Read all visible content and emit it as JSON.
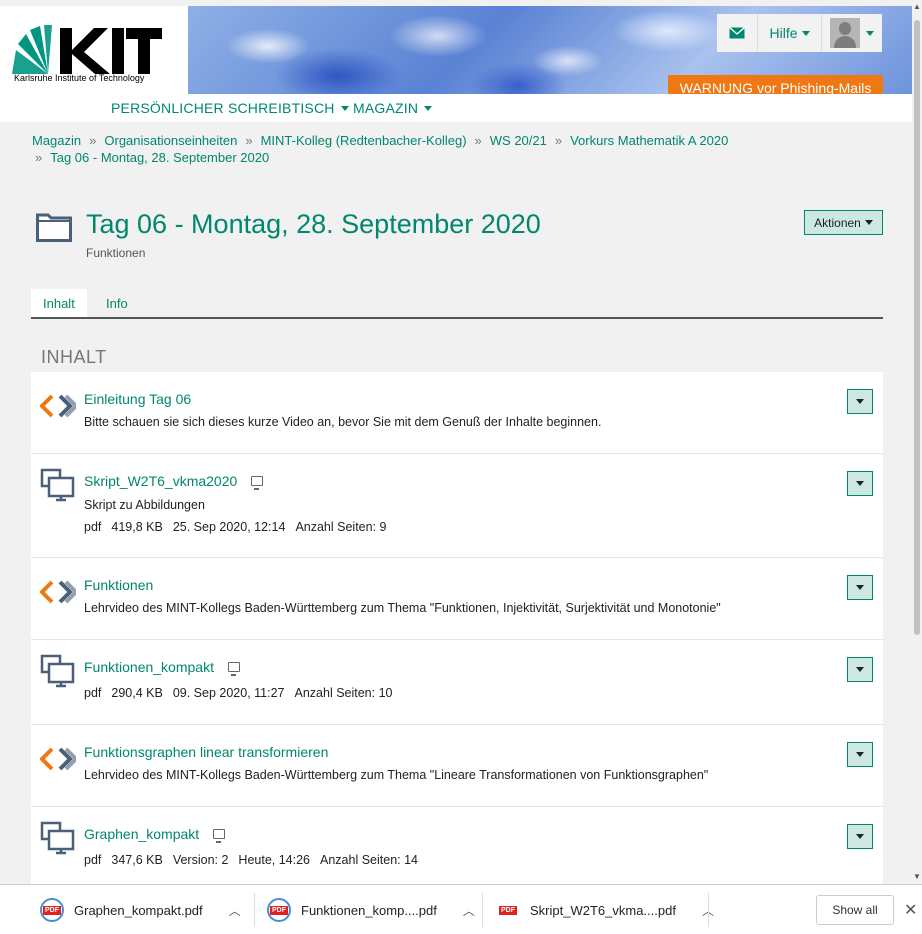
{
  "header": {
    "logo_text": "Karlsruhe Institute of Technology",
    "help_label": "Hilfe",
    "warning_label": "WARNUNG vor Phishing-Mails"
  },
  "mainnav": {
    "items": [
      {
        "label": "PERSÖNLICHER SCHREIBTISCH"
      },
      {
        "label": "MAGAZIN"
      }
    ]
  },
  "breadcrumb": [
    "Magazin",
    "Organisationseinheiten",
    "MINT-Kolleg (Redtenbacher-Kolleg)",
    "WS 20/21",
    "Vorkurs Mathematik A 2020",
    "Tag 06 - Montag, 28. September 2020"
  ],
  "page": {
    "title": "Tag 06 - Montag, 28. September 2020",
    "subtitle": "Funktionen",
    "actions_label": "Aktionen"
  },
  "tabs": [
    {
      "label": "Inhalt",
      "active": true
    },
    {
      "label": "Info",
      "active": false
    }
  ],
  "section_heading": "INHALT",
  "items": [
    {
      "type": "video",
      "title": "Einleitung Tag 06",
      "desc": "Bitte schauen sie sich dieses kurze Video an, bevor Sie mit dem Genuß der Inhalte beginnen."
    },
    {
      "type": "file",
      "title": "Skript_W2T6_vkma2020",
      "desc": "Skript zu Abbildungen",
      "meta": [
        "pdf",
        "419,8 KB",
        "25. Sep 2020, 12:14",
        "Anzahl Seiten: 9"
      ]
    },
    {
      "type": "video",
      "title": "Funktionen",
      "desc": "Lehrvideo des MINT-Kollegs Baden-Württemberg zum Thema \"Funktionen, Injektivität, Surjektivität und Monotonie\""
    },
    {
      "type": "file",
      "title": "Funktionen_kompakt",
      "meta": [
        "pdf",
        "290,4 KB",
        "09. Sep 2020, 11:27",
        "Anzahl Seiten: 10"
      ]
    },
    {
      "type": "video",
      "title": "Funktionsgraphen linear transformieren",
      "desc": "Lehrvideo des MINT-Kollegs Baden-Württemberg zum Thema \"Lineare Transformationen von Funktionsgraphen\""
    },
    {
      "type": "file",
      "title": "Graphen_kompakt",
      "meta": [
        "pdf",
        "347,6 KB",
        "Version: 2",
        "Heute, 14:26",
        "Anzahl Seiten: 14"
      ]
    }
  ],
  "downloads": [
    {
      "name": "Graphen_kompakt.pdf"
    },
    {
      "name": "Funktionen_komp....pdf"
    },
    {
      "name": "Skript_W2T6_vkma....pdf"
    }
  ],
  "downloads_bar": {
    "show_all_label": "Show all"
  },
  "colors": {
    "accent": "#00876c",
    "warning": "#f07814",
    "button_bg": "#cde8e2"
  }
}
